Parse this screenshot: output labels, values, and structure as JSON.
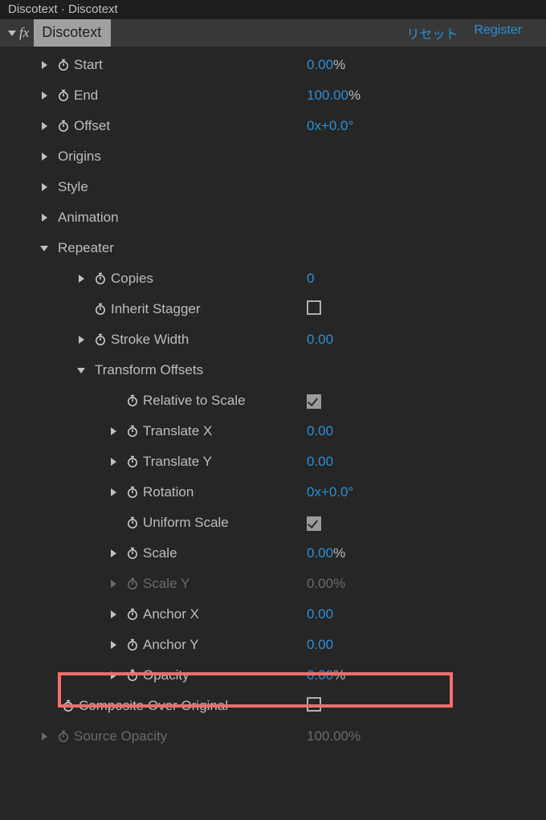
{
  "titlebar": "Discotext · Discotext",
  "effect": {
    "name": "Discotext",
    "reset": "リセット",
    "register": "Register"
  },
  "props": {
    "start": {
      "label": "Start",
      "value": "0.00",
      "unit": "%"
    },
    "end": {
      "label": "End",
      "value": "100.00",
      "unit": "%"
    },
    "offset": {
      "label": "Offset",
      "value": "0x+0.0°"
    },
    "origins": {
      "label": "Origins"
    },
    "style": {
      "label": "Style"
    },
    "animation": {
      "label": "Animation"
    },
    "repeater": {
      "label": "Repeater",
      "copies": {
        "label": "Copies",
        "value": "0"
      },
      "inherit": {
        "label": "Inherit Stagger",
        "checked": false
      },
      "stroke": {
        "label": "Stroke Width",
        "value": "0.00"
      },
      "transform": {
        "label": "Transform Offsets",
        "relScale": {
          "label": "Relative to Scale",
          "checked": true
        },
        "transX": {
          "label": "Translate X",
          "value": "0.00"
        },
        "transY": {
          "label": "Translate Y",
          "value": "0.00"
        },
        "rotation": {
          "label": "Rotation",
          "value": "0x+0.0°"
        },
        "uniform": {
          "label": "Uniform Scale",
          "checked": true
        },
        "scale": {
          "label": "Scale",
          "value": "0.00",
          "unit": "%"
        },
        "scaleY": {
          "label": "Scale Y",
          "value": "0.00",
          "unit": "%"
        },
        "anchorX": {
          "label": "Anchor X",
          "value": "0.00"
        },
        "anchorY": {
          "label": "Anchor Y",
          "value": "0.00"
        },
        "opacity": {
          "label": "Opacity",
          "value": "0.00",
          "unit": "%"
        }
      },
      "composite": {
        "label": "Composite Over Original",
        "checked": false
      }
    },
    "sourceOpacity": {
      "label": "Source Opacity",
      "value": "100.00",
      "unit": "%"
    }
  }
}
